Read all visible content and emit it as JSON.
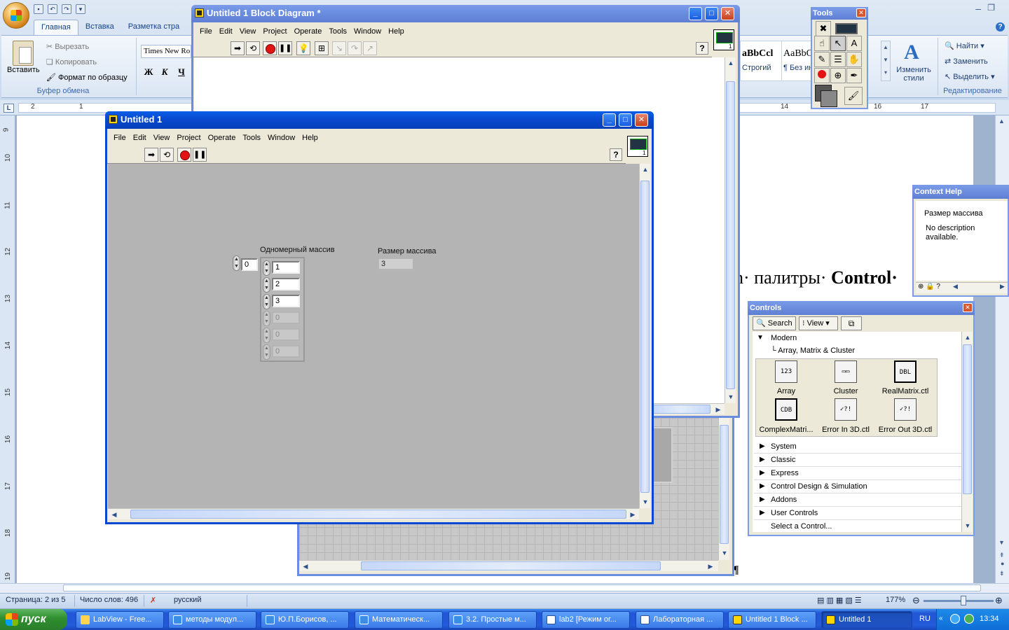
{
  "word": {
    "tabs": [
      "Главная",
      "Вставка",
      "Разметка стра"
    ],
    "clipboard": {
      "paste": "Вставить",
      "cut": "Вырезать",
      "copy": "Копировать",
      "format_painter": "Формат по образцу",
      "group_label": "Буфер обмена"
    },
    "font": {
      "name": "Times New Ro",
      "bold": "Ж",
      "italic": "К",
      "underline": "Ч"
    },
    "styles": [
      {
        "sample": "aBbCcl",
        "name": "Строгий"
      },
      {
        "sample": "AaBbC",
        "name": "¶ Без ин"
      }
    ],
    "change_styles": "Изменить стили",
    "editing": {
      "find": "Найти",
      "replace": "Заменить",
      "select": "Выделить",
      "group_label": "Редактирование"
    },
    "ruler_corner": "L",
    "h_ruler_numbers": [
      "2",
      "1",
      "14",
      "15",
      "16",
      "17"
    ],
    "v_ruler_numbers": [
      "9",
      "10",
      "11",
      "12",
      "13",
      "14",
      "15",
      "16",
      "17",
      "18",
      "19"
    ],
    "doc_text_plain": "n· палитры· ",
    "doc_text_bold": "Control·",
    "status": {
      "page": "Страница: 2 из 5",
      "words": "Число слов: 496",
      "language": "русский",
      "zoom": "177%"
    }
  },
  "block_diagram": {
    "title": "Untitled 1 Block Diagram *",
    "menu": [
      "File",
      "Edit",
      "View",
      "Project",
      "Operate",
      "Tools",
      "Window",
      "Help"
    ],
    "vi_icon_num": "1"
  },
  "front_panel": {
    "title": "Untitled 1",
    "menu": [
      "File",
      "Edit",
      "View",
      "Project",
      "Operate",
      "Tools",
      "Window",
      "Help"
    ],
    "vi_icon_num": "1",
    "array_label": "Одномерный массив",
    "array_index": "0",
    "array_values": [
      "1",
      "2",
      "3",
      "0",
      "0",
      "0"
    ],
    "size_label": "Размер массива",
    "size_value": "3"
  },
  "tools_palette": {
    "title": "Tools"
  },
  "context_help": {
    "title": "Context Help",
    "heading": "Размер массива",
    "body": "No description available."
  },
  "controls_palette": {
    "title": "Controls",
    "search": "Search",
    "view": "View",
    "modern": "Modern",
    "sub_path": "Array, Matrix & Cluster",
    "items": [
      {
        "label": "Array",
        "icon": "123"
      },
      {
        "label": "Cluster",
        "icon": "▭▭"
      },
      {
        "label": "RealMatrix.ctl",
        "icon": "DBL"
      },
      {
        "label": "ComplexMatri...",
        "icon": "CDB"
      },
      {
        "label": "Error In 3D.ctl",
        "icon": "✓?!"
      },
      {
        "label": "Error Out 3D.ctl",
        "icon": "✓?!"
      }
    ],
    "categories": [
      "System",
      "Classic",
      "Express",
      "Control Design & Simulation",
      "Addons",
      "User Controls",
      "Select a Control..."
    ]
  },
  "taskbar": {
    "start": "пуск",
    "tasks": [
      {
        "label": "LabView - Free...",
        "color": "#ffd34f"
      },
      {
        "label": "методы модул...",
        "color": "#3a8ee6"
      },
      {
        "label": "Ю.П.Борисов, ...",
        "color": "#3a8ee6"
      },
      {
        "label": "Математическ...",
        "color": "#3a8ee6"
      },
      {
        "label": "3.2. Простые м...",
        "color": "#3a8ee6"
      },
      {
        "label": "lab2 [Режим ог...",
        "color": "#ffffff"
      },
      {
        "label": "Лабораторная ...",
        "color": "#ffffff"
      },
      {
        "label": "Untitled 1 Block ...",
        "color": "#ffd600"
      },
      {
        "label": "Untitled 1",
        "color": "#ffd600"
      }
    ],
    "lang": "RU",
    "clock": "13:34"
  }
}
